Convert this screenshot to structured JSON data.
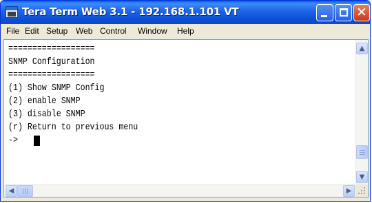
{
  "window": {
    "title": "Tera Term Web 3.1 - 192.168.1.101 VT",
    "app_icon": "tera-term-monitor-icon",
    "controls": {
      "minimize_icon": "minimize-icon",
      "maximize_icon": "maximize-icon",
      "close_icon": "close-icon",
      "close_glyph": "✕"
    }
  },
  "menu": {
    "items": [
      {
        "label": "File"
      },
      {
        "label": "Edit"
      },
      {
        "label": "Setup"
      },
      {
        "label": "Web"
      },
      {
        "label": "Control"
      },
      {
        "label": "Window"
      },
      {
        "label": "Help"
      }
    ]
  },
  "terminal": {
    "lines": [
      "==================",
      "SNMP Configuration",
      "==================",
      "(1) Show SNMP Config",
      "(2) enable SNMP",
      "(3) disable SNMP",
      "(r) Return to previous menu",
      "->"
    ]
  },
  "scrollbars": {
    "up_arrow": "▲",
    "down_arrow": "▼",
    "left_arrow": "◀",
    "right_arrow": "▶"
  },
  "colors": {
    "titlebar": "#0a4fd8",
    "close_button": "#c4391a",
    "terminal_background": "#ffffff",
    "terminal_text": "#000000"
  }
}
